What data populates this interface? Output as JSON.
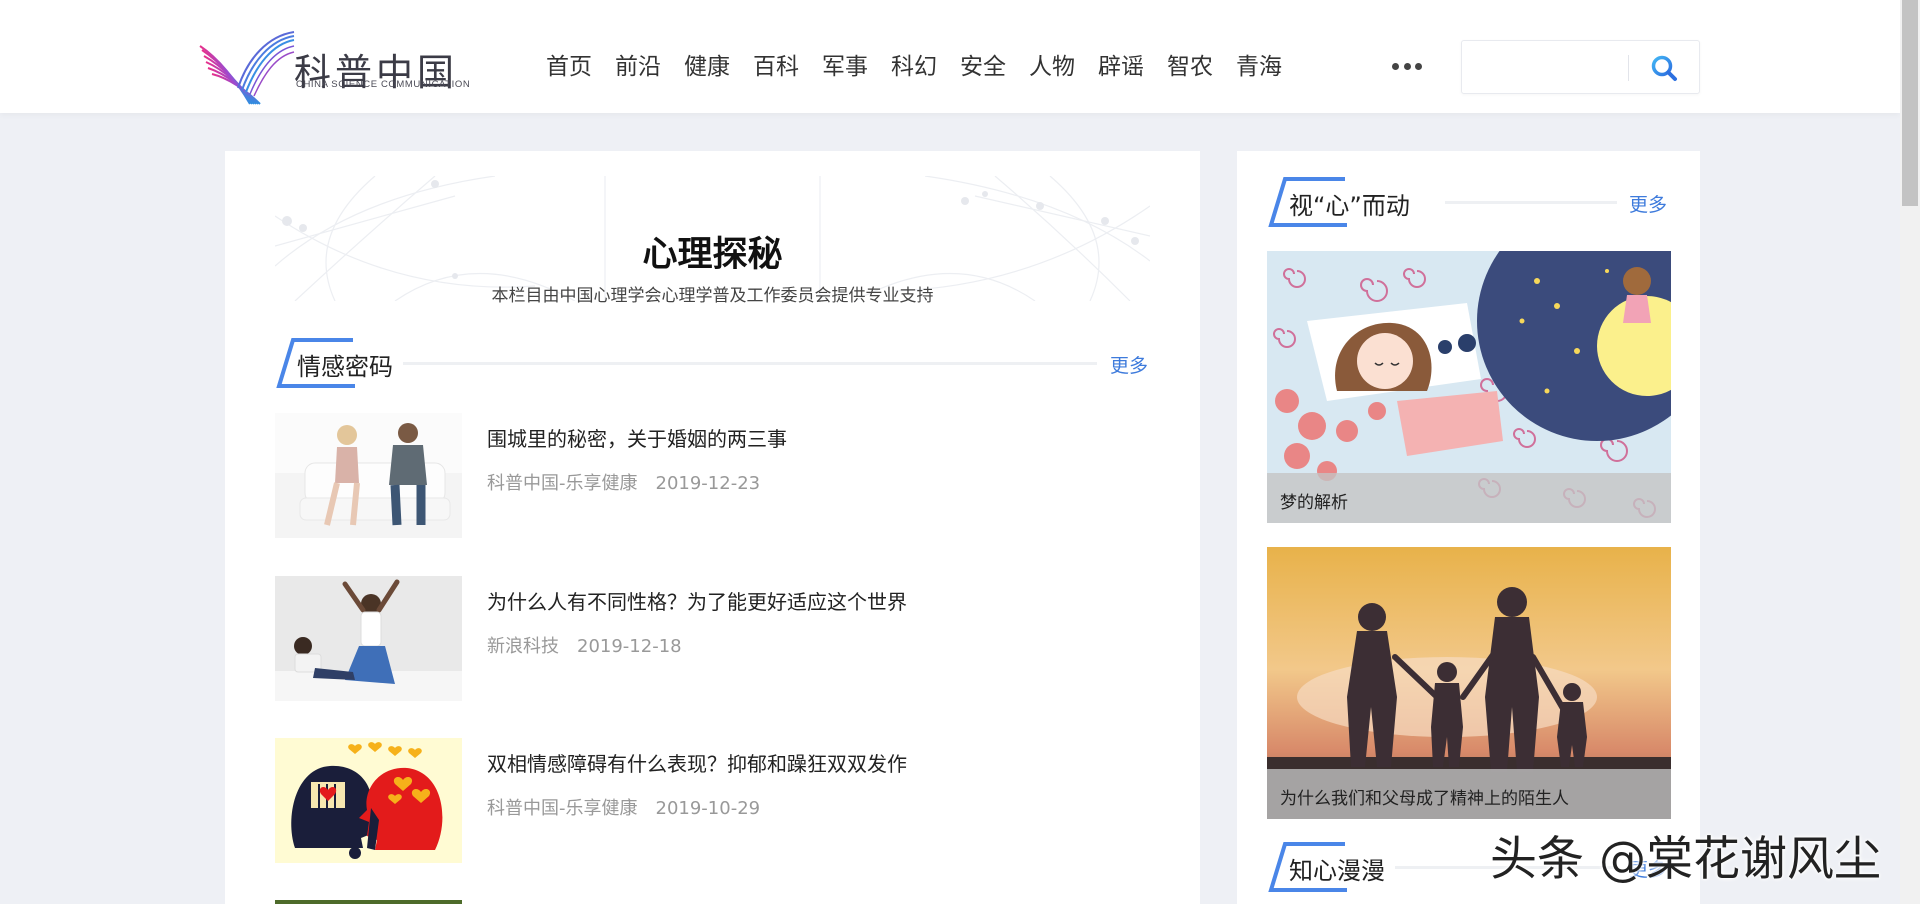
{
  "header": {
    "logo_cn": "科普中国",
    "logo_en": "CHINA SCIENCE COMMUNICATION",
    "nav": [
      "首页",
      "前沿",
      "健康",
      "百科",
      "军事",
      "科幻",
      "安全",
      "人物",
      "辟谣",
      "智农",
      "青海"
    ],
    "more_icon": "more-dots-icon",
    "search": {
      "value": "",
      "placeholder": "",
      "icon": "search-icon"
    }
  },
  "main": {
    "banner_title": "心理探秘",
    "banner_subtitle": "本栏目由中国心理学会心理学普及工作委员会提供专业支持",
    "section": {
      "title": "情感密码",
      "more": "更多"
    },
    "articles": [
      {
        "title": "围城里的秘密，关于婚姻的两三事",
        "source": "科普中国-乐享健康",
        "date": "2019-12-23"
      },
      {
        "title": "为什么人有不同性格？为了能更好适应这个世界",
        "source": "新浪科技",
        "date": "2019-12-18"
      },
      {
        "title": "双相情感障碍有什么表现？抑郁和躁狂双双发作",
        "source": "科普中国-乐享健康",
        "date": "2019-10-29"
      }
    ]
  },
  "side": {
    "section1": {
      "title": "视“心”而动",
      "more": "更多"
    },
    "cards": [
      {
        "caption": "梦的解析"
      },
      {
        "caption": "为什么我们和父母成了精神上的陌生人"
      }
    ],
    "section2": {
      "title": "知心漫漫",
      "more": "更多"
    }
  },
  "watermark": "头条 @棠花谢风尘",
  "colors": {
    "accent": "#3e7bdc",
    "bracket": "#4a86e8",
    "background": "#eef0f5"
  }
}
